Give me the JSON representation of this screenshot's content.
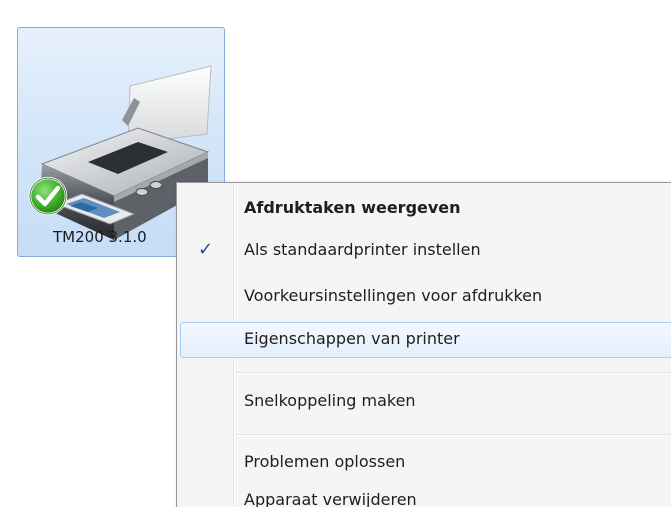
{
  "printer": {
    "label": "TM200 3.1.0"
  },
  "icons": {
    "printer": "printer-icon",
    "default_badge": "default-check-badge-icon",
    "checkmark": "checkmark-icon"
  },
  "colors": {
    "selection_fill": "#d4e6f9",
    "selection_border": "#84acdd",
    "menu_background": "#f5f5f5",
    "menu_highlight": "#e3effd",
    "check_blue": "#274aa8",
    "default_badge_green": "#3fae2a"
  },
  "context_menu": {
    "items": [
      {
        "label": "Afdruktaken weergeven",
        "bold": true,
        "checked": false
      },
      {
        "label": "Als standaardprinter instellen",
        "bold": false,
        "checked": true,
        "check_glyph": "✓"
      },
      {
        "label": "Voorkeursinstellingen voor afdrukken",
        "bold": false,
        "checked": false
      },
      {
        "label": "Eigenschappen van printer",
        "bold": false,
        "checked": false,
        "highlighted": true
      },
      {
        "label": "Snelkoppeling maken",
        "bold": false,
        "checked": false
      },
      {
        "label": "Problemen oplossen",
        "bold": false,
        "checked": false
      },
      {
        "label": "Apparaat verwijderen",
        "bold": false,
        "checked": false
      }
    ]
  }
}
